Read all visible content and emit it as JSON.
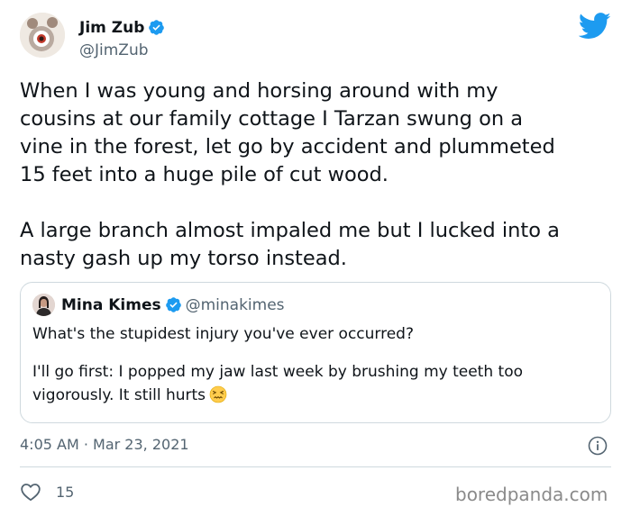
{
  "author": {
    "name": "Jim Zub",
    "handle": "@JimZub",
    "verified": true
  },
  "tweet": {
    "paragraph1": [
      "When I was young and horsing around with my",
      "cousins at our family cottage I Tarzan swung on a",
      "vine in the forest, let go by accident and plummeted",
      "15 feet into a huge pile of cut wood."
    ],
    "paragraph2": [
      "A large branch almost impaled me but I lucked into a",
      "nasty gash up my torso instead."
    ]
  },
  "quoted_tweet": {
    "name": "Mina Kimes",
    "handle": "@minakimes",
    "verified": true,
    "line1": "What's the stupidest injury you've ever occurred?",
    "line2": "I'll go first: I popped my jaw last week by brushing my teeth too",
    "line3": "vigorously. It still hurts",
    "emoji": "confounded-face"
  },
  "meta": {
    "timestamp": "4:05 AM · Mar 23, 2021",
    "likes": "15"
  },
  "watermark": "boredpanda.com",
  "colors": {
    "twitter_blue": "#1d9bf0",
    "secondary_text": "#536471",
    "border": "#cfd9de"
  }
}
